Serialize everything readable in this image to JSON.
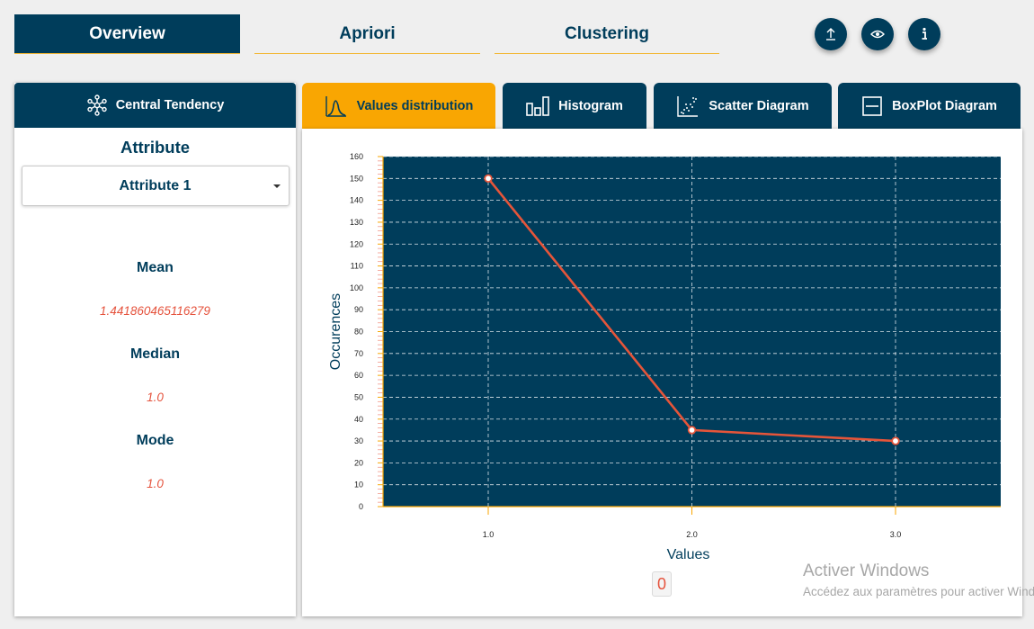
{
  "nav": {
    "tabs": [
      {
        "label": "Overview",
        "active": true
      },
      {
        "label": "Apriori",
        "active": false
      },
      {
        "label": "Clustering",
        "active": false
      }
    ],
    "buttons": [
      {
        "icon": "upload-icon"
      },
      {
        "icon": "eye-icon"
      },
      {
        "icon": "info-icon"
      }
    ]
  },
  "left_panel": {
    "header": "Central Tendency",
    "header_icon": "network-nodes-icon",
    "attribute_title": "Attribute",
    "attribute_select": "Attribute 1",
    "mean_label": "Mean",
    "mean_value": "1.441860465116279",
    "median_label": "Median",
    "median_value": "1.0",
    "mode_label": "Mode",
    "mode_value": "1.0"
  },
  "chart_tabs": [
    {
      "label": "Values distribution",
      "icon": "distribution-curve-icon",
      "active": true
    },
    {
      "label": "Histogram",
      "icon": "histogram-icon",
      "active": false
    },
    {
      "label": "Scatter Diagram",
      "icon": "scatter-icon",
      "active": false
    },
    {
      "label": "BoxPlot Diagram",
      "icon": "boxplot-icon",
      "active": false
    }
  ],
  "chart_data": {
    "type": "line",
    "x": [
      "1.0",
      "2.0",
      "3.0"
    ],
    "values": [
      150,
      35,
      30
    ],
    "xlabel": "Values",
    "ylabel": "Occurences",
    "ylim": [
      0,
      160
    ],
    "y_ticks": [
      0,
      10,
      20,
      30,
      40,
      50,
      60,
      70,
      80,
      90,
      100,
      110,
      120,
      130,
      140,
      150,
      160
    ],
    "grid": true,
    "colors": {
      "plot_bg": "#003d5b",
      "line": "#e5553a",
      "grid": "#d9e2e8",
      "axis": "#f9a602"
    }
  },
  "counter_value": "0",
  "watermark": {
    "title": "Activer Windows",
    "subtitle": "Accédez aux paramètres pour activer Windows."
  },
  "colors": {
    "primary": "#003d5b",
    "accent": "#f9a602",
    "value_text": "#e5533d"
  }
}
